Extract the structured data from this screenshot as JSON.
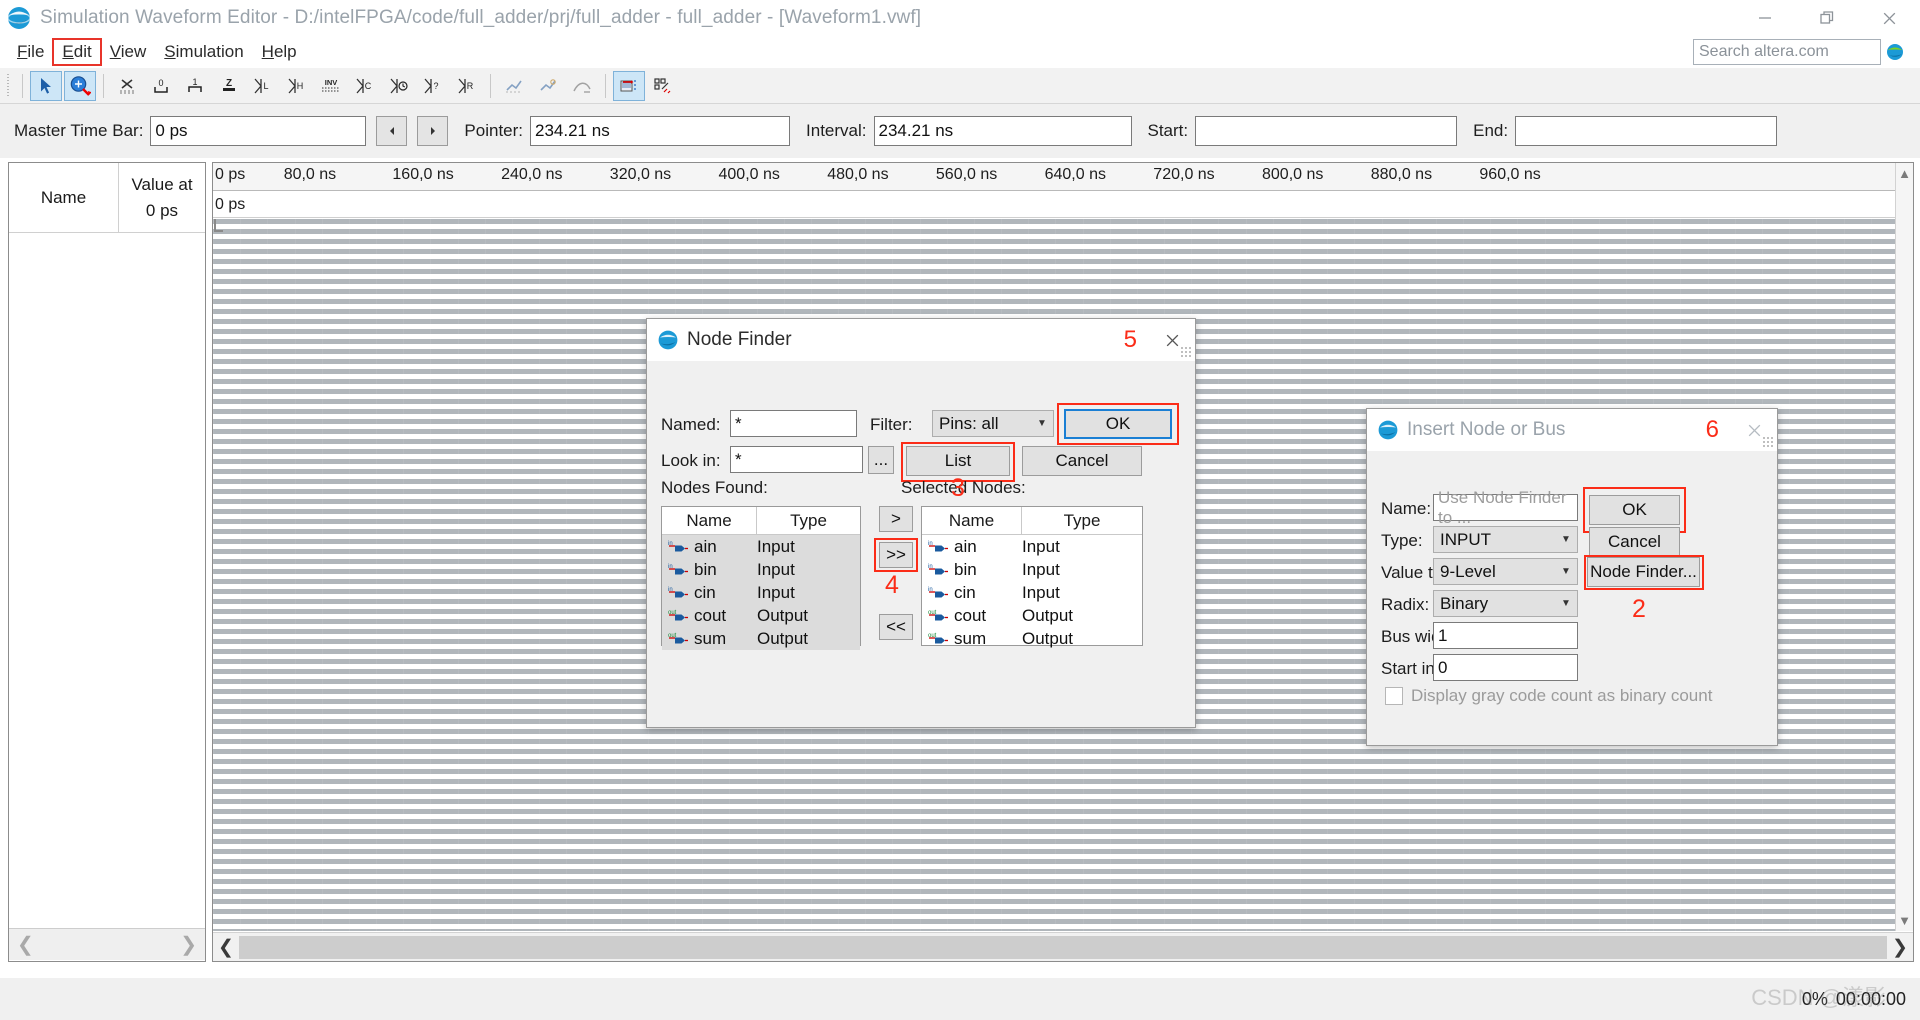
{
  "window": {
    "title": "Simulation Waveform Editor - D:/intelFPGA/code/full_adder/prj/full_adder - full_adder - [Waveform1.vwf]",
    "icon": "quartus-globe-icon",
    "minimize": "minimize-icon",
    "restore": "restore-icon",
    "close": "close-icon"
  },
  "menu": {
    "items": [
      {
        "label": "File",
        "accel": "F"
      },
      {
        "label": "Edit",
        "accel": "E"
      },
      {
        "label": "View",
        "accel": "V"
      },
      {
        "label": "Simulation",
        "accel": "S"
      },
      {
        "label": "Help",
        "accel": "H"
      }
    ],
    "highlighted": "Edit",
    "search": {
      "placeholder": "Search altera.com",
      "value": ""
    }
  },
  "toolbar": {
    "buttons": [
      {
        "name": "selection-tool",
        "glyph": "arrow",
        "active": true
      },
      {
        "name": "zoom-tool",
        "glyph": "zoom",
        "active": true
      },
      {
        "name": "waveform-editing-tool",
        "glyph": "x-scribble",
        "active": false
      },
      {
        "name": "forcing-low-0",
        "glyph": "0",
        "active": false
      },
      {
        "name": "forcing-high-1",
        "glyph": "1",
        "active": false
      },
      {
        "name": "high-impedance-z",
        "glyph": "Z",
        "active": false
      },
      {
        "name": "weak-low-l",
        "glyph": "L",
        "active": false
      },
      {
        "name": "weak-high-h",
        "glyph": "H",
        "active": false
      },
      {
        "name": "invert-inv",
        "glyph": "INV",
        "active": false
      },
      {
        "name": "count-value-c",
        "glyph": "C",
        "active": false
      },
      {
        "name": "clock-value",
        "glyph": "clock",
        "active": false
      },
      {
        "name": "arbitrary-value",
        "glyph": "?",
        "active": false
      },
      {
        "name": "random-value-r",
        "glyph": "R",
        "active": false
      },
      {
        "name": "snap-to-grid",
        "glyph": "snap1",
        "active": false
      },
      {
        "name": "snap-to-transition",
        "glyph": "snap2",
        "active": false
      },
      {
        "name": "sort-nodes",
        "glyph": "sort",
        "active": false
      },
      {
        "name": "show-grid",
        "glyph": "grid-red",
        "active": true
      },
      {
        "name": "node-properties",
        "glyph": "nodes",
        "active": false
      }
    ]
  },
  "timebar": {
    "master_time_bar_label": "Master Time Bar:",
    "master_time_bar_value": "0 ps",
    "prev_button": "prev-transition-icon",
    "next_button": "next-transition-icon",
    "pointer_label": "Pointer:",
    "pointer_value": "234.21 ns",
    "interval_label": "Interval:",
    "interval_value": "234.21 ns",
    "start_label": "Start:",
    "start_value": "",
    "end_label": "End:",
    "end_value": ""
  },
  "waveform": {
    "name_column": "Name",
    "value_column_line1": "Value at",
    "value_column_line2": "0 ps",
    "master_time_label": "0 ps",
    "rows": [],
    "ruler_ticks": [
      "0 ps",
      "80,0 ns",
      "160,0 ns",
      "240,0 ns",
      "320,0 ns",
      "400,0 ns",
      "480,0 ns",
      "560,0 ns",
      "640,0 ns",
      "720,0 ns",
      "800,0 ns",
      "880,0 ns",
      "960,0 ns"
    ],
    "scroll_left": "scroll-left-icon",
    "scroll_right": "scroll-right-icon",
    "scroll_up": "scroll-up-icon",
    "scroll_down": "scroll-down-icon"
  },
  "node_finder": {
    "title": "Node Finder",
    "annotation": "5",
    "named_label": "Named:",
    "named_value": "*",
    "filter_label": "Filter:",
    "filter_value": "Pins: all",
    "look_in_label": "Look in:",
    "look_in_value": "*",
    "browse_button": "...",
    "ok_button": "OK",
    "list_button": "List",
    "cancel_button": "Cancel",
    "nodes_found_label": "Nodes Found:",
    "selected_nodes_label": "Selected Nodes:",
    "selected_annotation": "3",
    "move_annotation": "4",
    "col_name": "Name",
    "col_type": "Type",
    "add_button": ">",
    "add_all_button": ">>",
    "remove_all_button": "<<",
    "nodes_found": [
      {
        "name": "ain",
        "type": "Input",
        "dir": "in"
      },
      {
        "name": "bin",
        "type": "Input",
        "dir": "in"
      },
      {
        "name": "cin",
        "type": "Input",
        "dir": "in"
      },
      {
        "name": "cout",
        "type": "Output",
        "dir": "out"
      },
      {
        "name": "sum",
        "type": "Output",
        "dir": "out"
      }
    ],
    "selected_nodes": [
      {
        "name": "ain",
        "type": "Input",
        "dir": "in"
      },
      {
        "name": "bin",
        "type": "Input",
        "dir": "in"
      },
      {
        "name": "cin",
        "type": "Input",
        "dir": "in"
      },
      {
        "name": "cout",
        "type": "Output",
        "dir": "out"
      },
      {
        "name": "sum",
        "type": "Output",
        "dir": "out"
      }
    ]
  },
  "insert_node": {
    "title": "Insert Node or Bus",
    "annotation": "6",
    "node_finder_annotation": "2",
    "name_label": "Name:",
    "name_placeholder": "Use Node Finder to ...",
    "name_value": "",
    "type_label": "Type:",
    "type_value": "INPUT",
    "value_type_label": "Value ty",
    "value_type_value": "9-Level",
    "radix_label": "Radix:",
    "radix_value": "Binary",
    "bus_width_label": "Bus wid",
    "bus_width_value": "1",
    "start_index_label": "Start in",
    "start_index_value": "0",
    "gray_code_label": "Display gray code count as binary count",
    "gray_code_checked": false,
    "ok_button": "OK",
    "cancel_button": "Cancel",
    "node_finder_button": "Node Finder..."
  },
  "status": {
    "progress": "0%",
    "elapsed": "00:00:00",
    "watermark": "CSDN @漾影"
  },
  "colors": {
    "annotation_red": "#fb2c18",
    "accent_blue": "#1a7fd4",
    "toolbar_active": "#cde6f7",
    "title_grey": "#9aa3ab"
  }
}
